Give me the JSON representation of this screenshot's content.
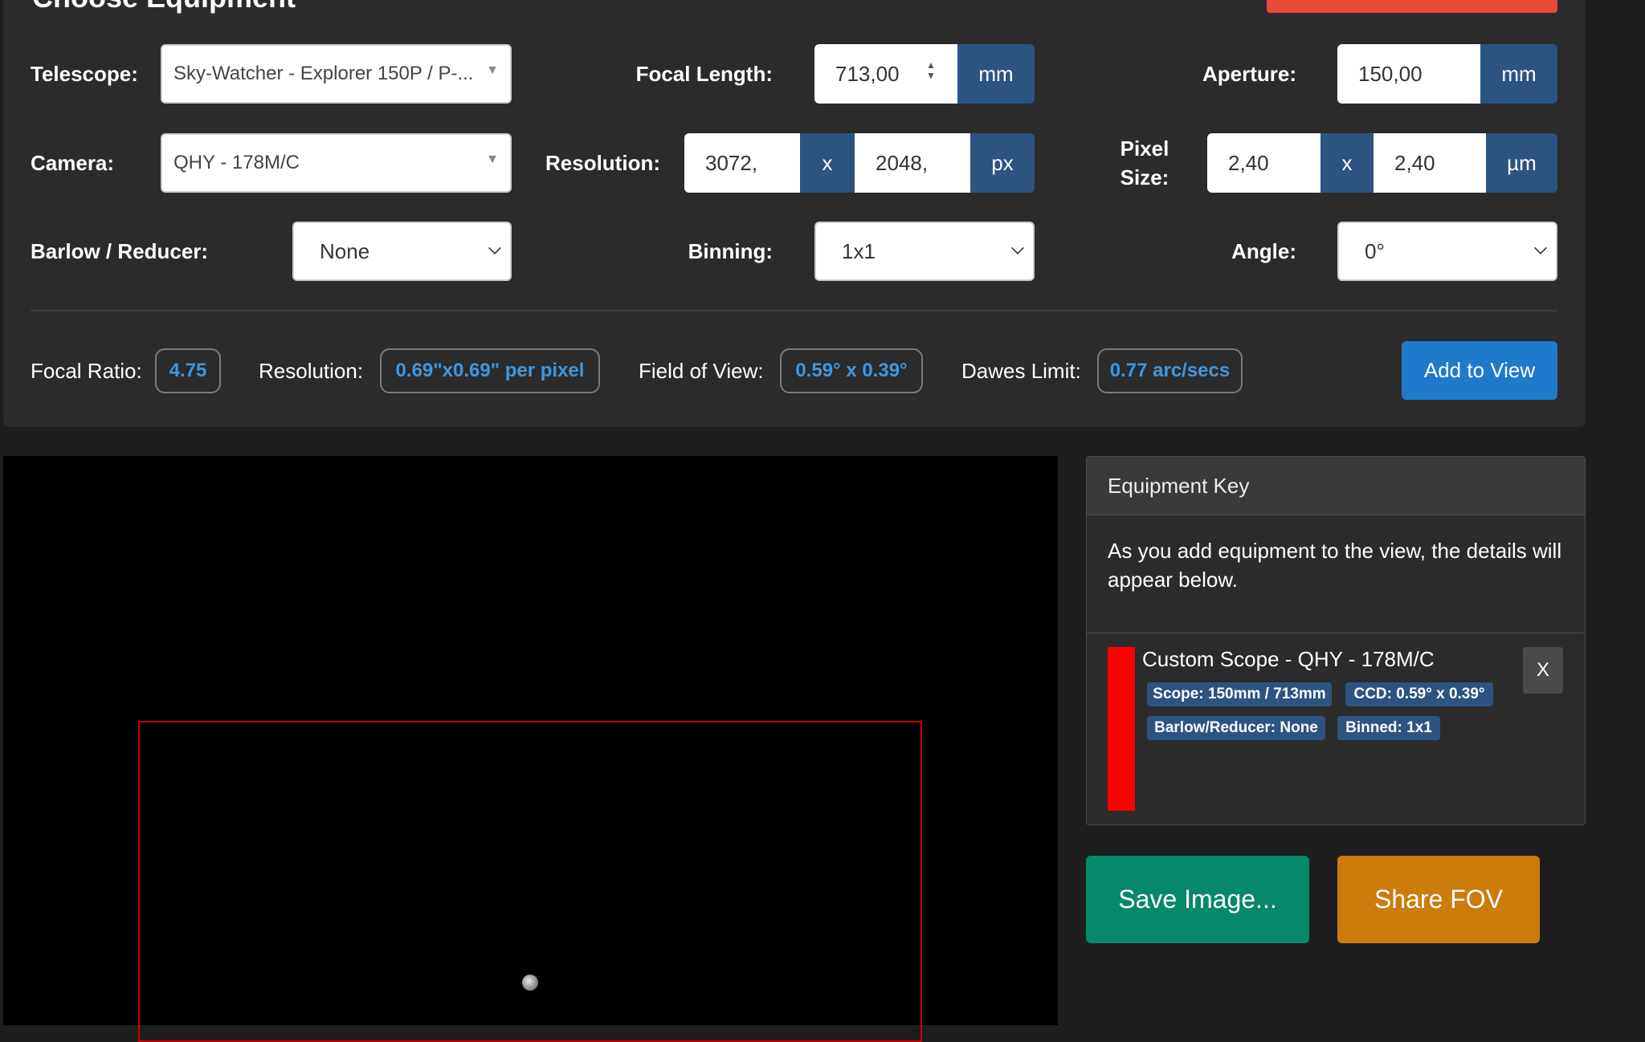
{
  "header": {
    "title": "Choose Equipment"
  },
  "colors": {
    "accent": "#1f7acc",
    "fov_outline": "#cc0000",
    "save": "#06886a",
    "share": "#cb7c0a",
    "stat_value": "#3f97e0"
  },
  "telescope": {
    "label": "Telescope:",
    "value": "Sky-Watcher - Explorer 150P / P-..."
  },
  "focal_length": {
    "label": "Focal Length:",
    "value": "713,00",
    "unit": "mm"
  },
  "aperture": {
    "label": "Aperture:",
    "value": "150,00",
    "unit": "mm"
  },
  "camera": {
    "label": "Camera:",
    "value": "QHY - 178M/C"
  },
  "resolution_input": {
    "label": "Resolution:",
    "width": "3072,",
    "sep": "x",
    "height": "2048,",
    "unit": "px"
  },
  "pixel_size": {
    "label_line1": "Pixel",
    "label_line2": "Size:",
    "width": "2,40",
    "sep": "x",
    "height": "2,40",
    "unit": "µm"
  },
  "barlow": {
    "label": "Barlow / Reducer:",
    "value": "None"
  },
  "binning": {
    "label": "Binning:",
    "value": "1x1"
  },
  "angle": {
    "label": "Angle:",
    "value": "0°"
  },
  "stats": {
    "focal_ratio": {
      "label": "Focal Ratio:",
      "value": "4.75"
    },
    "resolution": {
      "label": "Resolution:",
      "value": "0.69\"x0.69\" per pixel"
    },
    "fov": {
      "label": "Field of View:",
      "value": "0.59° x 0.39°"
    },
    "dawes": {
      "label": "Dawes Limit:",
      "value": "0.77 arc/secs"
    }
  },
  "add_button": "Add to View",
  "equipment_key": {
    "title": "Equipment Key",
    "description": "As you add equipment to the view, the details will appear below.",
    "entry": {
      "title": "Custom Scope - QHY - 178M/C",
      "tags": [
        "Scope: 150mm / 713mm",
        "CCD: 0.59° x 0.39°",
        "Barlow/Reducer: None",
        "Binned: 1x1"
      ],
      "remove_label": "X",
      "color": "#ff0000"
    }
  },
  "actions": {
    "save": "Save Image...",
    "share": "Share FOV"
  }
}
